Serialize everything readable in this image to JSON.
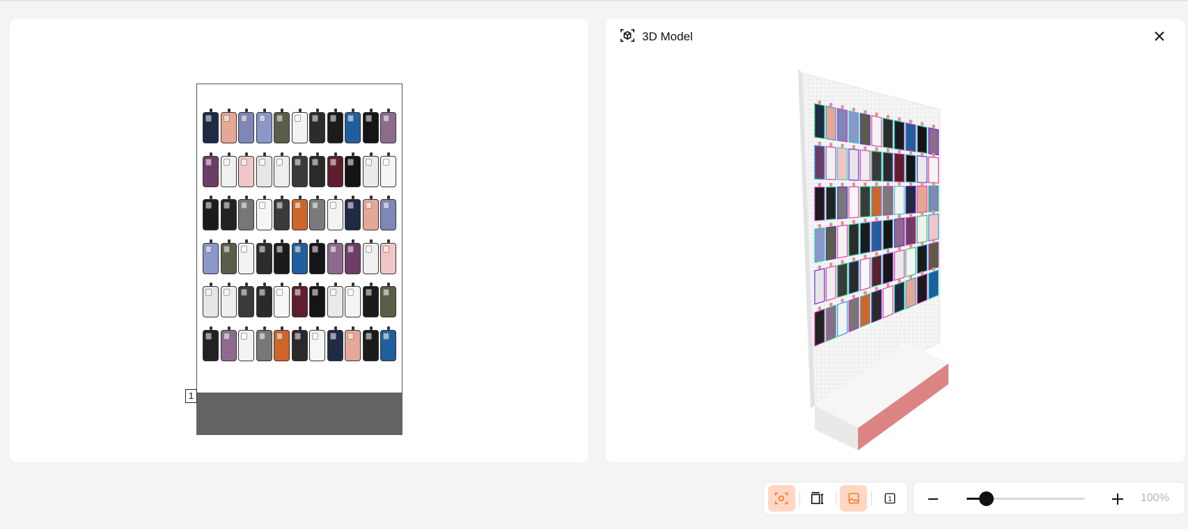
{
  "planogram": {
    "fixture_number": "1",
    "rows": [
      [
        "#1f2a44",
        "#e6a896",
        "#7f86b8",
        "#8b96c9",
        "#5a5e48",
        "#f3f3f3",
        "#2c2c2c",
        "#1b1b1b",
        "#1f5f9e",
        "#151515",
        "#8e6a8e"
      ],
      [
        "#6c3e67",
        "#f0f0f0",
        "#f2c6c6",
        "#e6e6e6",
        "#eeeeee",
        "#3a3a3a",
        "#2a2a2a",
        "#5e1e2e",
        "#151515",
        "#eaeaea",
        "#f5f5f5"
      ],
      [
        "#1b1b1b",
        "#222222",
        "#777777",
        "#f6f6f6",
        "#3a3a3a",
        "#d0652a",
        "#7a7a7a",
        "#f3f3f3",
        "#1f2a44",
        "#e6a896",
        "#7f86b8"
      ],
      [
        "#8b96c9",
        "#5a5e48",
        "#f3f3f3",
        "#2c2c2c",
        "#1b1b1b",
        "#1f5f9e",
        "#151515",
        "#8e6a8e",
        "#6c3e67",
        "#f0f0f0",
        "#f2c6c6"
      ],
      [
        "#e6e6e6",
        "#eeeeee",
        "#3a3a3a",
        "#2a2a2a",
        "#f7f7f7",
        "#5e1e2e",
        "#151515",
        "#eaeaea",
        "#f5f5f5",
        "#1b1b1b",
        "#5a5e48"
      ],
      [
        "#222222",
        "#8e6a8e",
        "#f3f3f3",
        "#777777",
        "#d0652a",
        "#2a2a2a",
        "#f6f6f6",
        "#1f2a44",
        "#e6a896",
        "#1b1b1b",
        "#1f5f9e"
      ]
    ]
  },
  "model_panel": {
    "title": "3D Model",
    "icon": "cube-scan-icon",
    "close_icon": "close-icon"
  },
  "toolbar": {
    "buttons": [
      {
        "icon": "focus-scan-icon",
        "active": true
      },
      {
        "icon": "dimension-icon",
        "active": false
      },
      {
        "icon": "image-icon",
        "active": true
      },
      {
        "icon": "fixture-number-icon",
        "label": "1",
        "active": false
      }
    ]
  },
  "zoom": {
    "value": "100%",
    "level": 0.16,
    "minus_icon": "minus-icon",
    "plus_icon": "plus-icon"
  },
  "colors": {
    "accent": "#f27a2a",
    "accent_bg": "#ffd7c2",
    "base_gray": "#646464",
    "plinth_pink": "#d98080"
  }
}
